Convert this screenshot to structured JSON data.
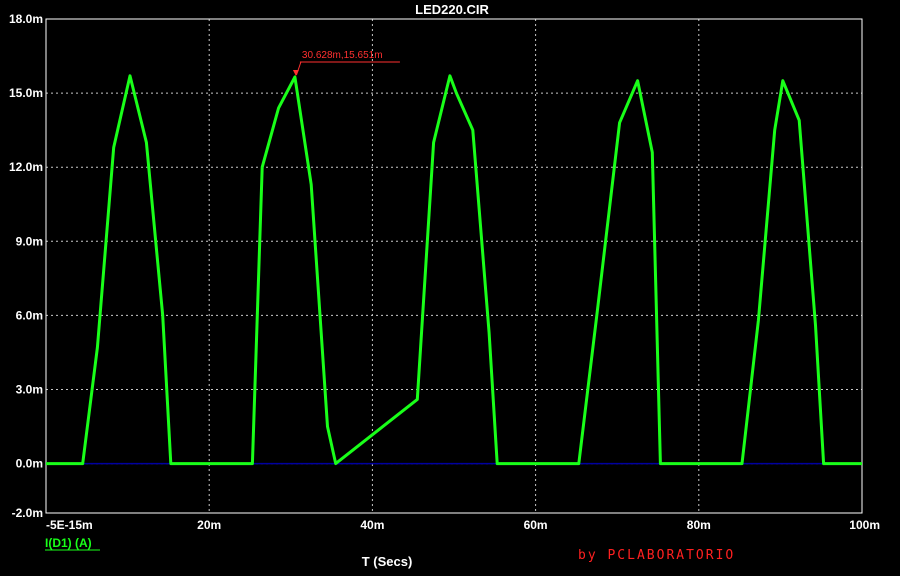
{
  "chart_data": {
    "type": "line",
    "title": "LED220.CIR",
    "xlabel": "T (Secs)",
    "ylabel": "",
    "xlim": [
      -5e-15,
      0.1
    ],
    "ylim": [
      -0.002,
      0.018
    ],
    "grid": true,
    "x_ticks": [
      -5e-15,
      0.02,
      0.04,
      0.06,
      0.08,
      0.1
    ],
    "x_tick_labels": [
      "-5E-15m",
      "20m",
      "40m",
      "60m",
      "80m",
      "100m"
    ],
    "y_ticks": [
      0.018,
      0.015,
      0.012,
      0.009,
      0.006,
      0.003,
      0.0,
      -0.002
    ],
    "y_tick_labels": [
      "18.0m",
      "15.0m",
      "12.0m",
      "9.0m",
      "6.0m",
      "3.0m",
      "0.0m",
      "-2.0m"
    ],
    "series": [
      {
        "name": "I(D1) (A)",
        "color": "#19ff19",
        "x": [
          0,
          0.0045,
          0.0063,
          0.0083,
          0.0103,
          0.0123,
          0.0143,
          0.0153,
          0.0253,
          0.0265,
          0.0285,
          0.0305,
          0.0325,
          0.0345,
          0.0355,
          0.0455,
          0.0475,
          0.0495,
          0.0503,
          0.0523,
          0.0543,
          0.0553,
          0.0653,
          0.0675,
          0.0703,
          0.0725,
          0.0743,
          0.0753,
          0.0853,
          0.0873,
          0.0893,
          0.0903,
          0.0923,
          0.0943,
          0.0953,
          0.1
        ],
        "y": [
          0,
          0,
          0.0047,
          0.0128,
          0.0157,
          0.013,
          0.006,
          0,
          0,
          0.012,
          0.0144,
          0.01565,
          0.0113,
          0.0015,
          0,
          0.0026,
          0.013,
          0.0157,
          0.015,
          0.0135,
          0.0053,
          0,
          0,
          0.006,
          0.0138,
          0.0155,
          0.0126,
          0,
          0,
          0.0058,
          0.0135,
          0.0155,
          0.0139,
          0.0056,
          0,
          0
        ]
      },
      {
        "name": "baseline",
        "color": "#0000a0",
        "x": [
          0,
          0.1
        ],
        "y": [
          0,
          0
        ]
      }
    ],
    "annotations": [
      {
        "text": "30.628m,15.651m",
        "x": 0.030628,
        "y": 0.015651,
        "color": "#ff3030"
      }
    ]
  },
  "legend": {
    "label": "I(D1) (A)",
    "color": "#19ff19"
  },
  "credit": "by PCLABORATORIO",
  "colors": {
    "background": "#000000",
    "grid": "#c8c8c8",
    "trace": "#19ff19",
    "annotation": "#ff3030",
    "credit": "#ff2020"
  }
}
